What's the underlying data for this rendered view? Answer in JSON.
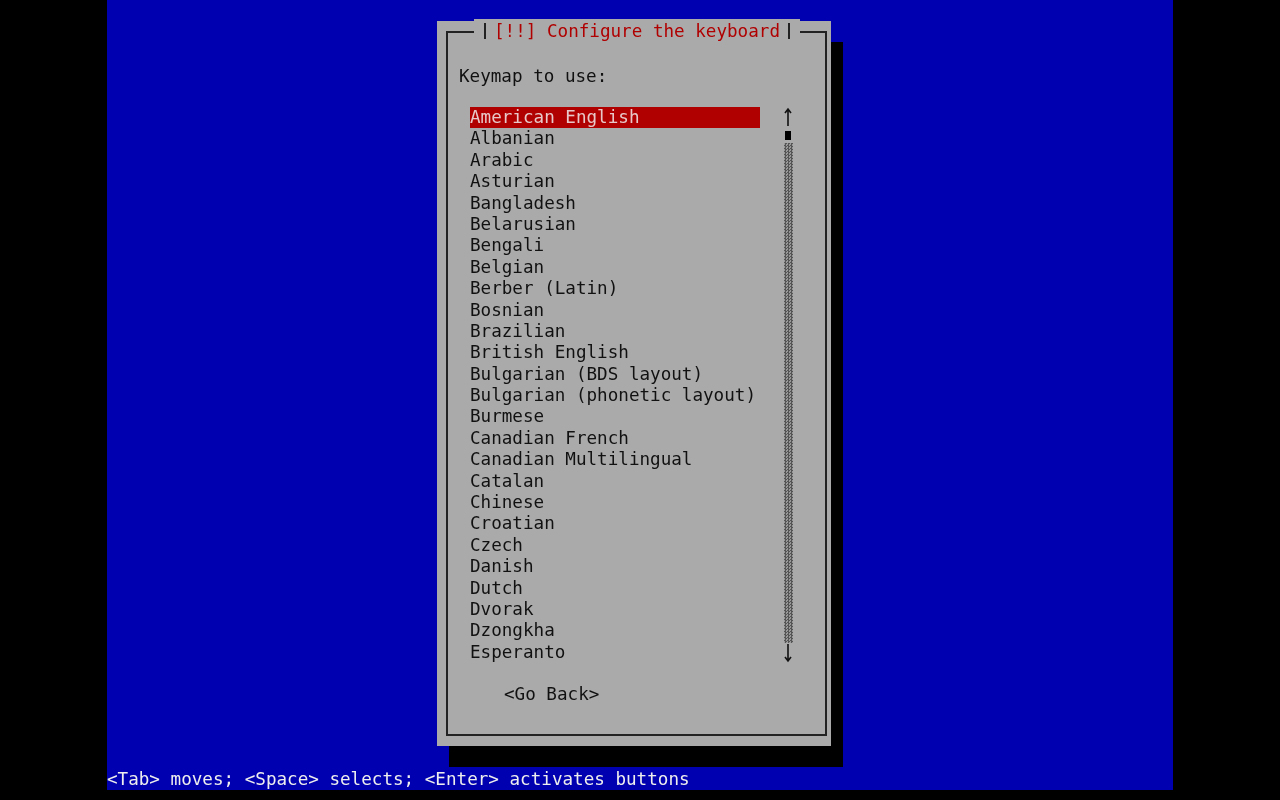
{
  "dialog": {
    "title": "[!!] Configure the keyboard",
    "prompt": "Keymap to use:",
    "items": [
      {
        "label": "American English",
        "selected": true
      },
      {
        "label": "Albanian",
        "selected": false
      },
      {
        "label": "Arabic",
        "selected": false
      },
      {
        "label": "Asturian",
        "selected": false
      },
      {
        "label": "Bangladesh",
        "selected": false
      },
      {
        "label": "Belarusian",
        "selected": false
      },
      {
        "label": "Bengali",
        "selected": false
      },
      {
        "label": "Belgian",
        "selected": false
      },
      {
        "label": "Berber (Latin)",
        "selected": false
      },
      {
        "label": "Bosnian",
        "selected": false
      },
      {
        "label": "Brazilian",
        "selected": false
      },
      {
        "label": "British English",
        "selected": false
      },
      {
        "label": "Bulgarian (BDS layout)",
        "selected": false
      },
      {
        "label": "Bulgarian (phonetic layout)",
        "selected": false
      },
      {
        "label": "Burmese",
        "selected": false
      },
      {
        "label": "Canadian French",
        "selected": false
      },
      {
        "label": "Canadian Multilingual",
        "selected": false
      },
      {
        "label": "Catalan",
        "selected": false
      },
      {
        "label": "Chinese",
        "selected": false
      },
      {
        "label": "Croatian",
        "selected": false
      },
      {
        "label": "Czech",
        "selected": false
      },
      {
        "label": "Danish",
        "selected": false
      },
      {
        "label": "Dutch",
        "selected": false
      },
      {
        "label": "Dvorak",
        "selected": false
      },
      {
        "label": "Dzongkha",
        "selected": false
      },
      {
        "label": "Esperanto",
        "selected": false
      }
    ],
    "button": "<Go Back>"
  },
  "status_bar": "<Tab> moves; <Space> selects; <Enter> activates buttons"
}
